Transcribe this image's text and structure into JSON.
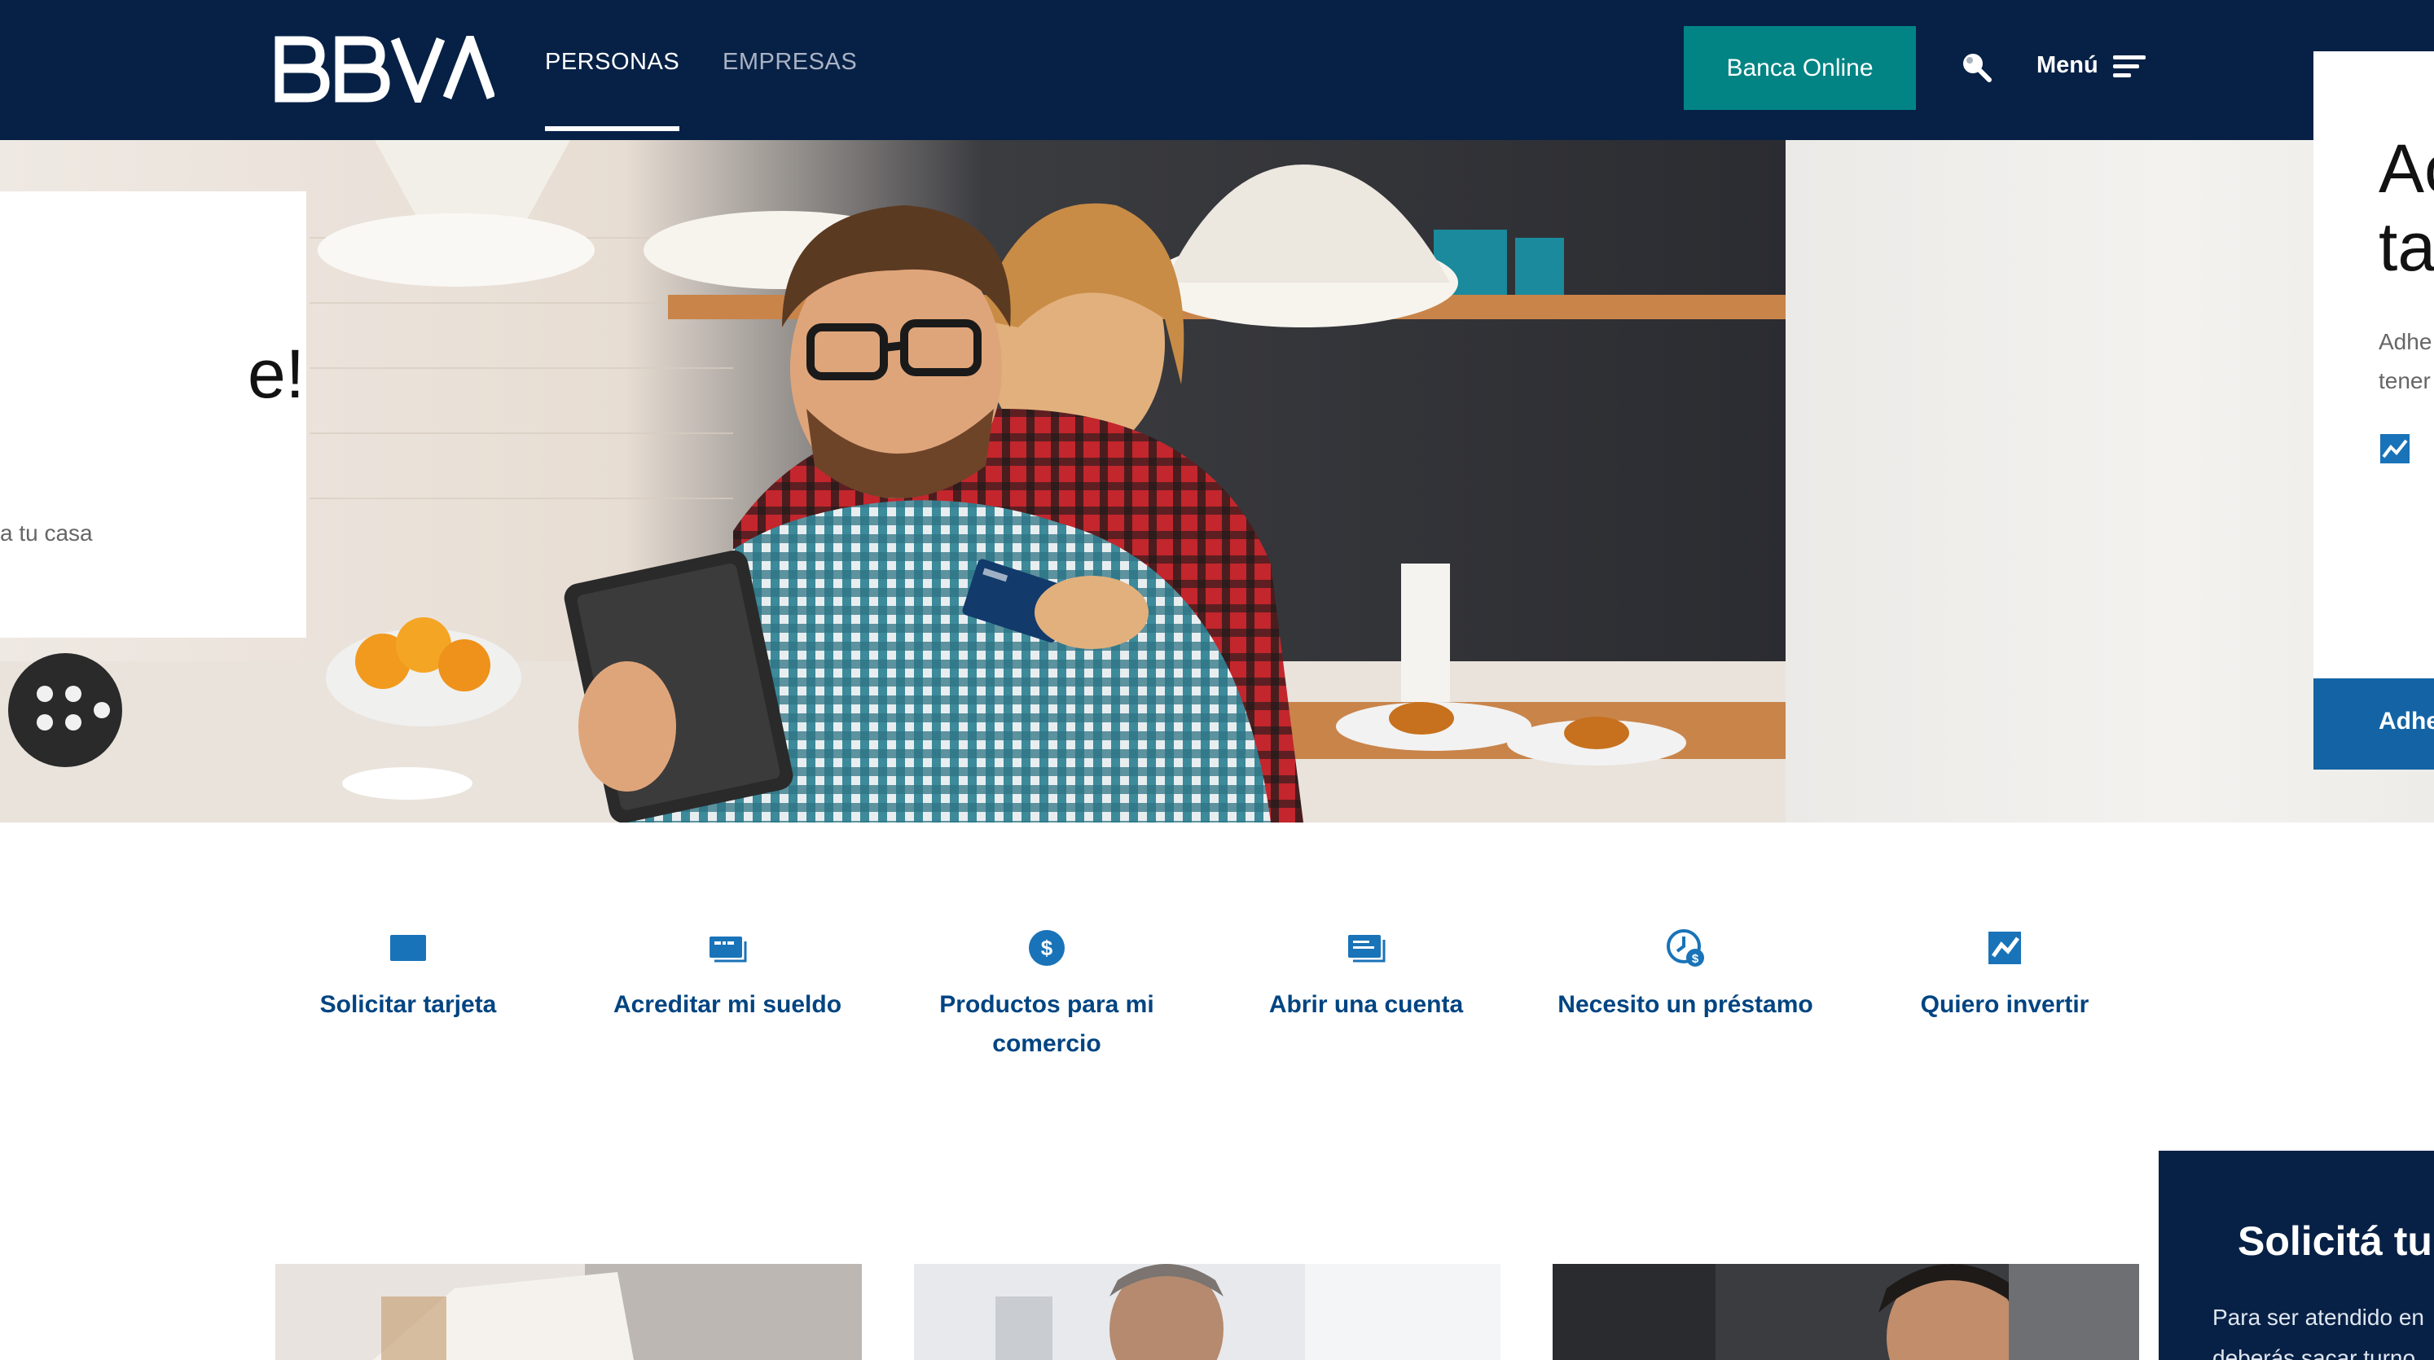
{
  "header": {
    "brand": "BBVA",
    "tabs": [
      {
        "label": "PERSONAS",
        "active": true
      },
      {
        "label": "EMPRESAS",
        "active": false
      }
    ],
    "online_button": "Banca Online",
    "menu_label": "Menú",
    "icons": {
      "search": "search-icon",
      "menu": "menu-icon"
    }
  },
  "hero": {
    "left_slide": {
      "title_fragment": "e!",
      "text_fragment": "a tu casa"
    },
    "right_slide": {
      "title_lines": [
        "Ac",
        "ta"
      ],
      "text_lines": [
        "Adhe",
        "tener"
      ],
      "button_label": "Adhe"
    }
  },
  "quick_access": [
    {
      "label": "Solicitar tarjeta",
      "icon": "card-icon"
    },
    {
      "label": "Acreditar mi sueldo",
      "icon": "salary-icon"
    },
    {
      "label": "Productos para mi comercio",
      "icon": "dollar-coin-icon"
    },
    {
      "label": "Abrir una cuenta",
      "icon": "account-icon"
    },
    {
      "label": "Necesito un préstamo",
      "icon": "loan-clock-icon"
    },
    {
      "label": "Quiero invertir",
      "icon": "invest-chart-icon"
    }
  ],
  "float_box": {
    "title": "Solicitá tu",
    "text_lines": [
      "Para ser atendido en",
      "deberás sacar turno"
    ]
  },
  "colors": {
    "navy": "#072146",
    "teal": "#028484",
    "blue": "#004481",
    "accent_blue": "#1464a5",
    "icon_blue": "#1973b8"
  }
}
